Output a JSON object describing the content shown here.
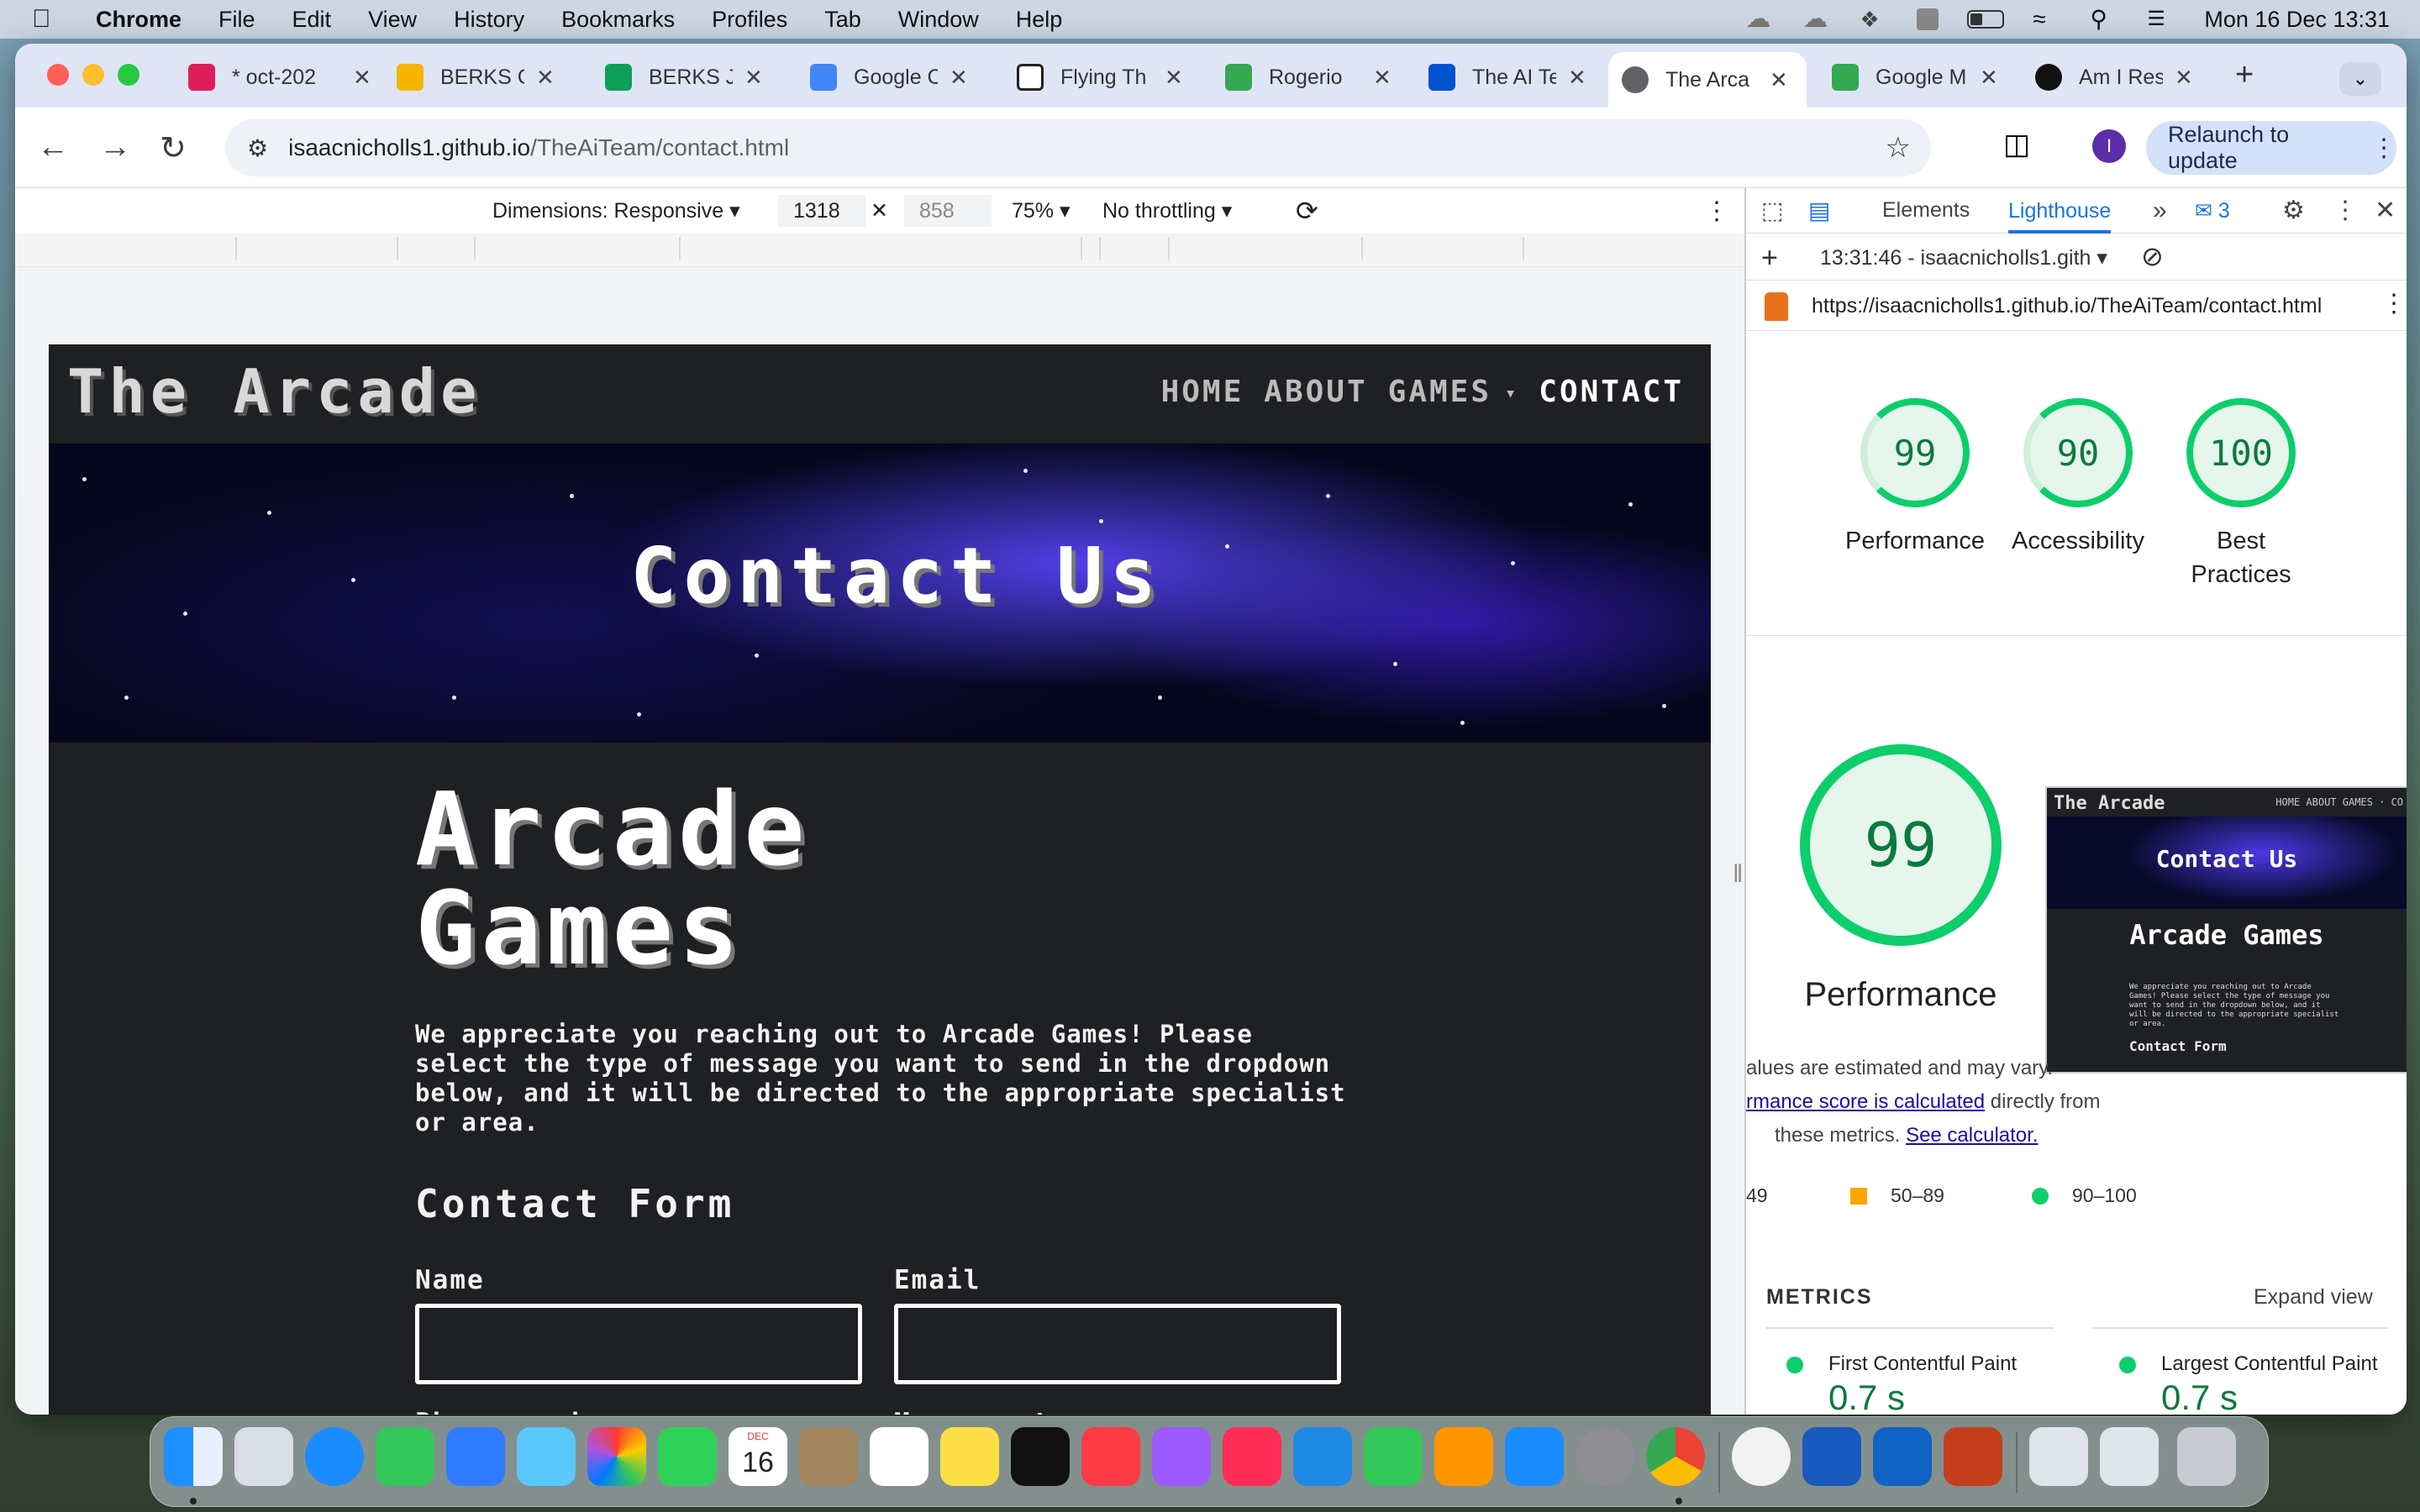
{
  "menubar": {
    "app": "Chrome",
    "items": [
      "File",
      "Edit",
      "View",
      "History",
      "Bookmarks",
      "Profiles",
      "Tab",
      "Window",
      "Help"
    ],
    "clock": "Mon 16 Dec  13:31"
  },
  "tabs": [
    {
      "title": "* oct-202",
      "color": "#e01e5a"
    },
    {
      "title": "BERKS C",
      "color": "#f4b400"
    },
    {
      "title": "BERKS Ja",
      "color": "#0f9d58"
    },
    {
      "title": "Google C",
      "color": "#4285f4"
    },
    {
      "title": "Flying Th",
      "color": "#222222"
    },
    {
      "title": "Rogerio",
      "color": "#34a853"
    },
    {
      "title": "The AI Te",
      "color": "#0052cc"
    },
    {
      "title": "The Arca",
      "color": "#5f6368",
      "active": true
    },
    {
      "title": "Google M",
      "color": "#34a853"
    },
    {
      "title": "Am I Res",
      "color": "#111111"
    }
  ],
  "toolbar": {
    "url_host": "isaacnicholls1.github.io",
    "url_path": "/TheAiTeam/contact.html",
    "relaunch": "Relaunch to update",
    "avatar_initial": "I"
  },
  "device_toolbar": {
    "dimensions": "Dimensions: Responsive",
    "width": "1318",
    "height": "858",
    "zoom": "75%",
    "throttling": "No throttling"
  },
  "site": {
    "logo": "The Arcade",
    "nav": [
      "HOME",
      "ABOUT",
      "GAMES",
      "CONTACT"
    ],
    "hero_title": "Contact Us",
    "heading": "Arcade Games",
    "lead": "We appreciate you reaching out to Arcade Games! Please select the type of message you want to send in the dropdown below, and it will be directed to the appropriate specialist or area.",
    "form_title": "Contact Form",
    "fields": {
      "name": "Name",
      "email": "Email",
      "phone": "Phone number",
      "message_type": "Message type"
    }
  },
  "devtools": {
    "tab_elements": "Elements",
    "tab_lighthouse": "Lighthouse",
    "issues_count": "3",
    "run_label": "13:31:46 - isaacnicholls1.gith",
    "report_url": "https://isaacnicholls1.github.io/TheAiTeam/contact.html",
    "scores": [
      {
        "value": "99",
        "label": "Performance"
      },
      {
        "value": "90",
        "label": "Accessibility"
      },
      {
        "value": "100",
        "label": "Best Practices"
      }
    ],
    "big_score": "99",
    "big_label": "Performance",
    "note_1": "alues are estimated and may vary.",
    "note_link": "rmance score is calculated",
    "note_2": "directly from",
    "note_3": "these metrics.",
    "note_calc": "See calculator.",
    "legend": [
      "49",
      "50–89",
      "90–100"
    ],
    "metrics_title": "METRICS",
    "expand": "Expand view",
    "metrics": [
      {
        "label": "First Contentful Paint",
        "value": "0.7 s"
      },
      {
        "label": "Largest Contentful Paint",
        "value": "0.7 s"
      }
    ],
    "colors": {
      "pass": "#0cce6b",
      "average": "#ffa400"
    }
  },
  "thumbnail": {
    "logo": "The Arcade",
    "nav": "HOME ABOUT GAMES · CO",
    "hero": "Contact Us",
    "heading": "Arcade Games",
    "lead": "We appreciate you reaching out to Arcade Games! Please select the type of message you want to send in the dropdown below, and it will be directed to the appropriate specialist or area.",
    "form_title": "Contact Form"
  },
  "dock": {
    "calendar_month": "DEC",
    "calendar_day": "16"
  }
}
